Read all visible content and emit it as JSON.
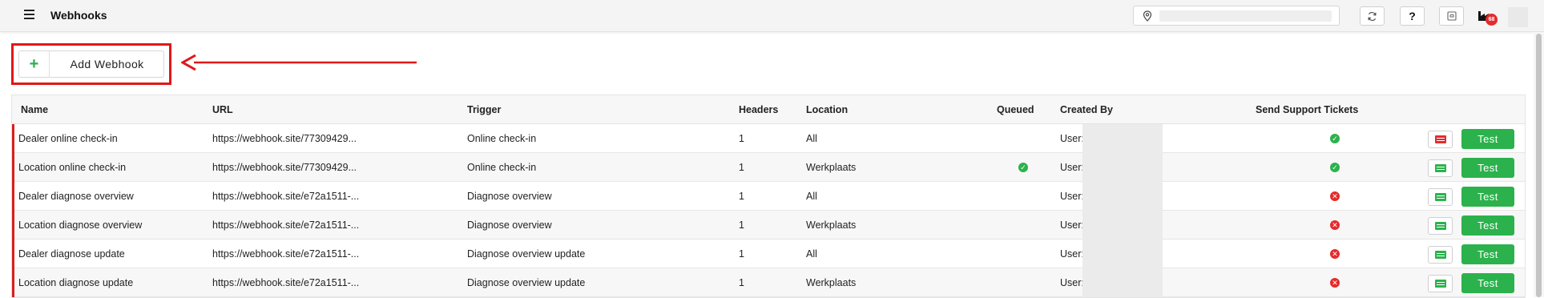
{
  "header": {
    "title": "Webhooks",
    "help_label": "?",
    "notification_count": "68"
  },
  "toolbar": {
    "add_label": "Add Webhook",
    "add_symbol": "+"
  },
  "table": {
    "columns": [
      "Name",
      "URL",
      "Trigger",
      "Headers",
      "Location",
      "Queued",
      "Created By",
      "Send Support Tickets"
    ],
    "test_label": "Test",
    "rows": [
      {
        "name": "Dealer online check-in",
        "url": "https://webhook.site/77309429...",
        "trigger": "Online check-in",
        "headers": "1",
        "location": "All",
        "queued": false,
        "created_by": "User:",
        "send_support_tickets": true,
        "ticket_icon_color": "#e52b2b"
      },
      {
        "name": "Location online check-in",
        "url": "https://webhook.site/77309429...",
        "trigger": "Online check-in",
        "headers": "1",
        "location": "Werkplaats",
        "queued": true,
        "created_by": "User:",
        "send_support_tickets": true,
        "ticket_icon_color": "#2bb24c"
      },
      {
        "name": "Dealer diagnose overview",
        "url": "https://webhook.site/e72a1511-...",
        "trigger": "Diagnose overview",
        "headers": "1",
        "location": "All",
        "queued": false,
        "created_by": "User:",
        "send_support_tickets": false,
        "ticket_icon_color": "#2bb24c"
      },
      {
        "name": "Location diagnose overview",
        "url": "https://webhook.site/e72a1511-...",
        "trigger": "Diagnose overview",
        "headers": "1",
        "location": "Werkplaats",
        "queued": false,
        "created_by": "User:",
        "send_support_tickets": false,
        "ticket_icon_color": "#2bb24c"
      },
      {
        "name": "Dealer diagnose update",
        "url": "https://webhook.site/e72a1511-...",
        "trigger": "Diagnose overview update",
        "headers": "1",
        "location": "All",
        "queued": false,
        "created_by": "User:",
        "send_support_tickets": false,
        "ticket_icon_color": "#2bb24c"
      },
      {
        "name": "Location diagnose update",
        "url": "https://webhook.site/e72a1511-...",
        "trigger": "Diagnose overview update",
        "headers": "1",
        "location": "Werkplaats",
        "queued": false,
        "created_by": "User:",
        "send_support_tickets": false,
        "ticket_icon_color": "#2bb24c"
      }
    ]
  },
  "colors": {
    "accent_green": "#2bb24c",
    "error_red": "#e52b2b",
    "highlight_red": "#e01818"
  },
  "icons": {
    "menu": "hamburger-icon",
    "location": "map-pin-icon",
    "refresh": "refresh-icon",
    "archive": "archive-icon",
    "notifications": "factory-icon",
    "ticket": "ticket-list-icon",
    "ok": "check-circle-icon",
    "error": "x-circle-icon"
  }
}
